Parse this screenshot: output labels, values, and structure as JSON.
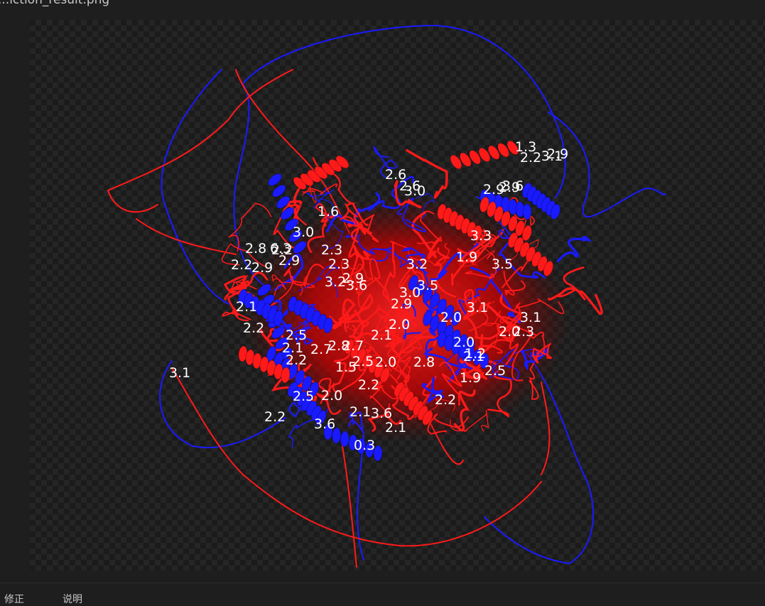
{
  "window": {
    "title": "...iction_result.png"
  },
  "status_bar": {
    "item_1": "修正",
    "item_2": "说明"
  },
  "image": {
    "backbone_colors": {
      "chain_a": "#1a1aff",
      "chain_b": "#ff1a1a",
      "label": "#ffffff"
    },
    "distance_labels": [
      "1.3",
      "2.9",
      "2.6",
      "3.0",
      "2.9",
      "1.6",
      "3.0",
      "2.8",
      "6.3",
      "2.2",
      "2.9",
      "2.9",
      "3.2",
      "3.6",
      "2.9",
      "3.1",
      "2.1",
      "2.0",
      "3.1",
      "2.1",
      "2.2",
      "2.8",
      "3.6",
      "2.1",
      "2.9",
      "3.6",
      "2.2",
      "1.2",
      "2.5",
      "1.9",
      "2.2",
      "2.8",
      "2.0",
      "2.5",
      "3.3",
      "2.0",
      "2.3",
      "2.7",
      "2.0",
      "2.1",
      "1.5",
      "0.3",
      "2.7",
      "2.3",
      "1.9",
      "2.0",
      "2.2",
      "3.2",
      "2.0",
      "2.5",
      "3.0",
      "2.1",
      "2.6",
      "3.5",
      "2.2",
      "2.9",
      "3.1",
      "2.3",
      "3.5",
      "3.1",
      "3.6",
      "2.1",
      "2.5",
      "2.2",
      "2.2"
    ]
  }
}
